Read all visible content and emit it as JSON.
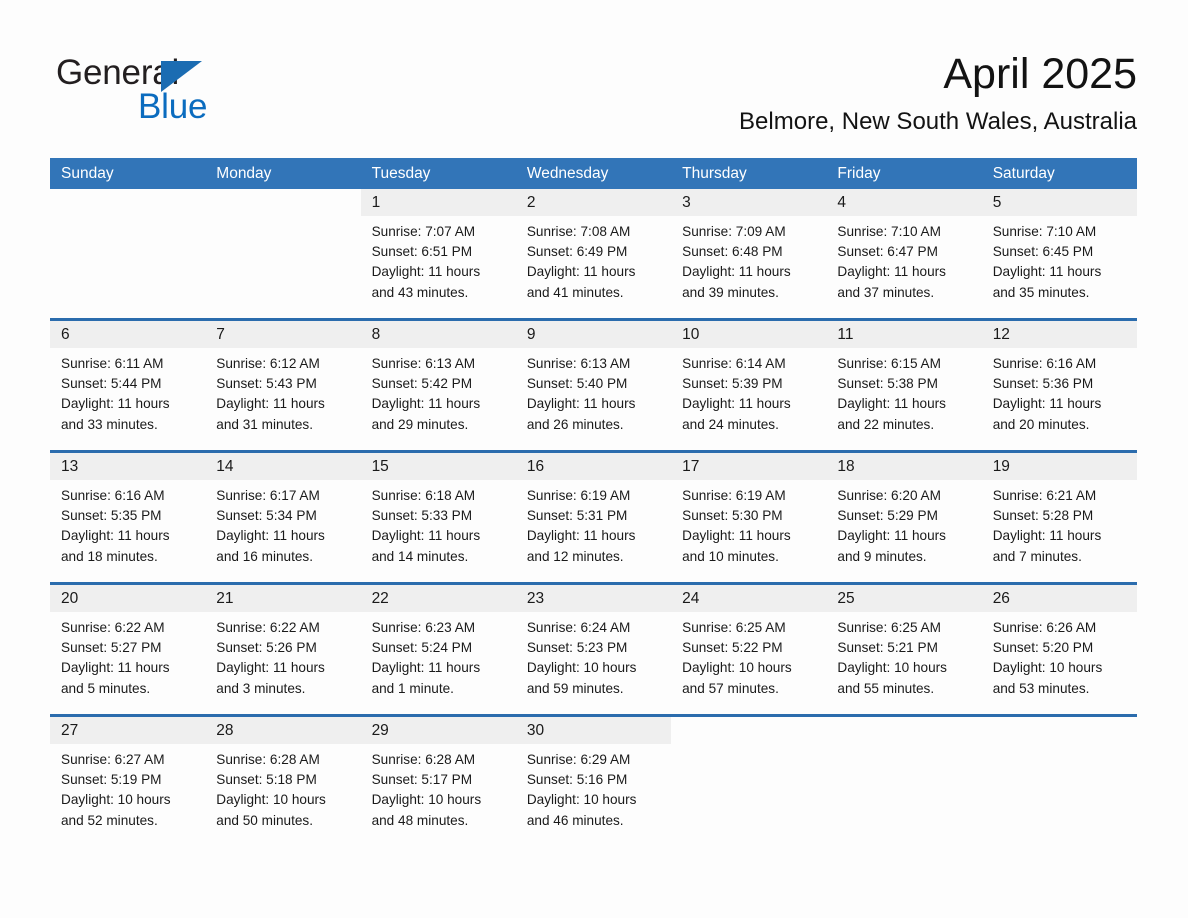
{
  "logo": {
    "word_one": "General",
    "word_two": "Blue",
    "triangle_color": "#1b6cb2",
    "blue_color": "#0b6cbf"
  },
  "header": {
    "title": "April 2025",
    "location": "Belmore, New South Wales, Australia"
  },
  "theme": {
    "header_bg": "#3275b8",
    "row_divider": "#2b6cad",
    "daynum_bg": "#efefef",
    "page_bg": "#fdfdfd"
  },
  "weekdays": [
    "Sunday",
    "Monday",
    "Tuesday",
    "Wednesday",
    "Thursday",
    "Friday",
    "Saturday"
  ],
  "weeks": [
    [
      {
        "blank": true
      },
      {
        "blank": true
      },
      {
        "day": "1",
        "sunrise": "Sunrise: 7:07 AM",
        "sunset": "Sunset: 6:51 PM",
        "daylight": "Daylight: 11 hours and 43 minutes."
      },
      {
        "day": "2",
        "sunrise": "Sunrise: 7:08 AM",
        "sunset": "Sunset: 6:49 PM",
        "daylight": "Daylight: 11 hours and 41 minutes."
      },
      {
        "day": "3",
        "sunrise": "Sunrise: 7:09 AM",
        "sunset": "Sunset: 6:48 PM",
        "daylight": "Daylight: 11 hours and 39 minutes."
      },
      {
        "day": "4",
        "sunrise": "Sunrise: 7:10 AM",
        "sunset": "Sunset: 6:47 PM",
        "daylight": "Daylight: 11 hours and 37 minutes."
      },
      {
        "day": "5",
        "sunrise": "Sunrise: 7:10 AM",
        "sunset": "Sunset: 6:45 PM",
        "daylight": "Daylight: 11 hours and 35 minutes."
      }
    ],
    [
      {
        "day": "6",
        "sunrise": "Sunrise: 6:11 AM",
        "sunset": "Sunset: 5:44 PM",
        "daylight": "Daylight: 11 hours and 33 minutes."
      },
      {
        "day": "7",
        "sunrise": "Sunrise: 6:12 AM",
        "sunset": "Sunset: 5:43 PM",
        "daylight": "Daylight: 11 hours and 31 minutes."
      },
      {
        "day": "8",
        "sunrise": "Sunrise: 6:13 AM",
        "sunset": "Sunset: 5:42 PM",
        "daylight": "Daylight: 11 hours and 29 minutes."
      },
      {
        "day": "9",
        "sunrise": "Sunrise: 6:13 AM",
        "sunset": "Sunset: 5:40 PM",
        "daylight": "Daylight: 11 hours and 26 minutes."
      },
      {
        "day": "10",
        "sunrise": "Sunrise: 6:14 AM",
        "sunset": "Sunset: 5:39 PM",
        "daylight": "Daylight: 11 hours and 24 minutes."
      },
      {
        "day": "11",
        "sunrise": "Sunrise: 6:15 AM",
        "sunset": "Sunset: 5:38 PM",
        "daylight": "Daylight: 11 hours and 22 minutes."
      },
      {
        "day": "12",
        "sunrise": "Sunrise: 6:16 AM",
        "sunset": "Sunset: 5:36 PM",
        "daylight": "Daylight: 11 hours and 20 minutes."
      }
    ],
    [
      {
        "day": "13",
        "sunrise": "Sunrise: 6:16 AM",
        "sunset": "Sunset: 5:35 PM",
        "daylight": "Daylight: 11 hours and 18 minutes."
      },
      {
        "day": "14",
        "sunrise": "Sunrise: 6:17 AM",
        "sunset": "Sunset: 5:34 PM",
        "daylight": "Daylight: 11 hours and 16 minutes."
      },
      {
        "day": "15",
        "sunrise": "Sunrise: 6:18 AM",
        "sunset": "Sunset: 5:33 PM",
        "daylight": "Daylight: 11 hours and 14 minutes."
      },
      {
        "day": "16",
        "sunrise": "Sunrise: 6:19 AM",
        "sunset": "Sunset: 5:31 PM",
        "daylight": "Daylight: 11 hours and 12 minutes."
      },
      {
        "day": "17",
        "sunrise": "Sunrise: 6:19 AM",
        "sunset": "Sunset: 5:30 PM",
        "daylight": "Daylight: 11 hours and 10 minutes."
      },
      {
        "day": "18",
        "sunrise": "Sunrise: 6:20 AM",
        "sunset": "Sunset: 5:29 PM",
        "daylight": "Daylight: 11 hours and 9 minutes."
      },
      {
        "day": "19",
        "sunrise": "Sunrise: 6:21 AM",
        "sunset": "Sunset: 5:28 PM",
        "daylight": "Daylight: 11 hours and 7 minutes."
      }
    ],
    [
      {
        "day": "20",
        "sunrise": "Sunrise: 6:22 AM",
        "sunset": "Sunset: 5:27 PM",
        "daylight": "Daylight: 11 hours and 5 minutes."
      },
      {
        "day": "21",
        "sunrise": "Sunrise: 6:22 AM",
        "sunset": "Sunset: 5:26 PM",
        "daylight": "Daylight: 11 hours and 3 minutes."
      },
      {
        "day": "22",
        "sunrise": "Sunrise: 6:23 AM",
        "sunset": "Sunset: 5:24 PM",
        "daylight": "Daylight: 11 hours and 1 minute."
      },
      {
        "day": "23",
        "sunrise": "Sunrise: 6:24 AM",
        "sunset": "Sunset: 5:23 PM",
        "daylight": "Daylight: 10 hours and 59 minutes."
      },
      {
        "day": "24",
        "sunrise": "Sunrise: 6:25 AM",
        "sunset": "Sunset: 5:22 PM",
        "daylight": "Daylight: 10 hours and 57 minutes."
      },
      {
        "day": "25",
        "sunrise": "Sunrise: 6:25 AM",
        "sunset": "Sunset: 5:21 PM",
        "daylight": "Daylight: 10 hours and 55 minutes."
      },
      {
        "day": "26",
        "sunrise": "Sunrise: 6:26 AM",
        "sunset": "Sunset: 5:20 PM",
        "daylight": "Daylight: 10 hours and 53 minutes."
      }
    ],
    [
      {
        "day": "27",
        "sunrise": "Sunrise: 6:27 AM",
        "sunset": "Sunset: 5:19 PM",
        "daylight": "Daylight: 10 hours and 52 minutes."
      },
      {
        "day": "28",
        "sunrise": "Sunrise: 6:28 AM",
        "sunset": "Sunset: 5:18 PM",
        "daylight": "Daylight: 10 hours and 50 minutes."
      },
      {
        "day": "29",
        "sunrise": "Sunrise: 6:28 AM",
        "sunset": "Sunset: 5:17 PM",
        "daylight": "Daylight: 10 hours and 48 minutes."
      },
      {
        "day": "30",
        "sunrise": "Sunrise: 6:29 AM",
        "sunset": "Sunset: 5:16 PM",
        "daylight": "Daylight: 10 hours and 46 minutes."
      },
      {
        "blank": true
      },
      {
        "blank": true
      },
      {
        "blank": true
      }
    ]
  ]
}
